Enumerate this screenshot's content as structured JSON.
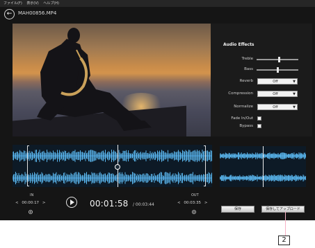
{
  "menu": {
    "items": [
      "ファイル(F)",
      "表示(V)",
      "ヘルプ(H)"
    ]
  },
  "header": {
    "filename": "MAH00856.MP4"
  },
  "audio_effects": {
    "title": "Audio Effects",
    "treble_label": "Treble",
    "treble_level": 0.55,
    "bass_label": "Bass",
    "bass_level": 0.5,
    "reverb_label": "Reverb",
    "reverb_value": "Off",
    "compression_label": "Compression",
    "compression_value": "Off",
    "normalize_label": "Normalize",
    "normalize_value": "Off",
    "fade_label": "Fade In/Out",
    "bypass_label": "Bypass"
  },
  "waveform": {
    "left_channel": "L",
    "right_channel": "R"
  },
  "markers": {
    "in_label": "IN",
    "in_time": "00:00:17",
    "out_label": "OUT",
    "out_time": "00:03:35"
  },
  "playback": {
    "current_time": "00:01:58",
    "total_time": "/ 00:03:44"
  },
  "buttons": {
    "save": "保存",
    "save_upload": "保存してアップロード"
  },
  "callout": {
    "number": "2"
  },
  "colors": {
    "waveform": "#5bb8f0",
    "background": "#151515",
    "callout_line": "#f7b2c6"
  }
}
